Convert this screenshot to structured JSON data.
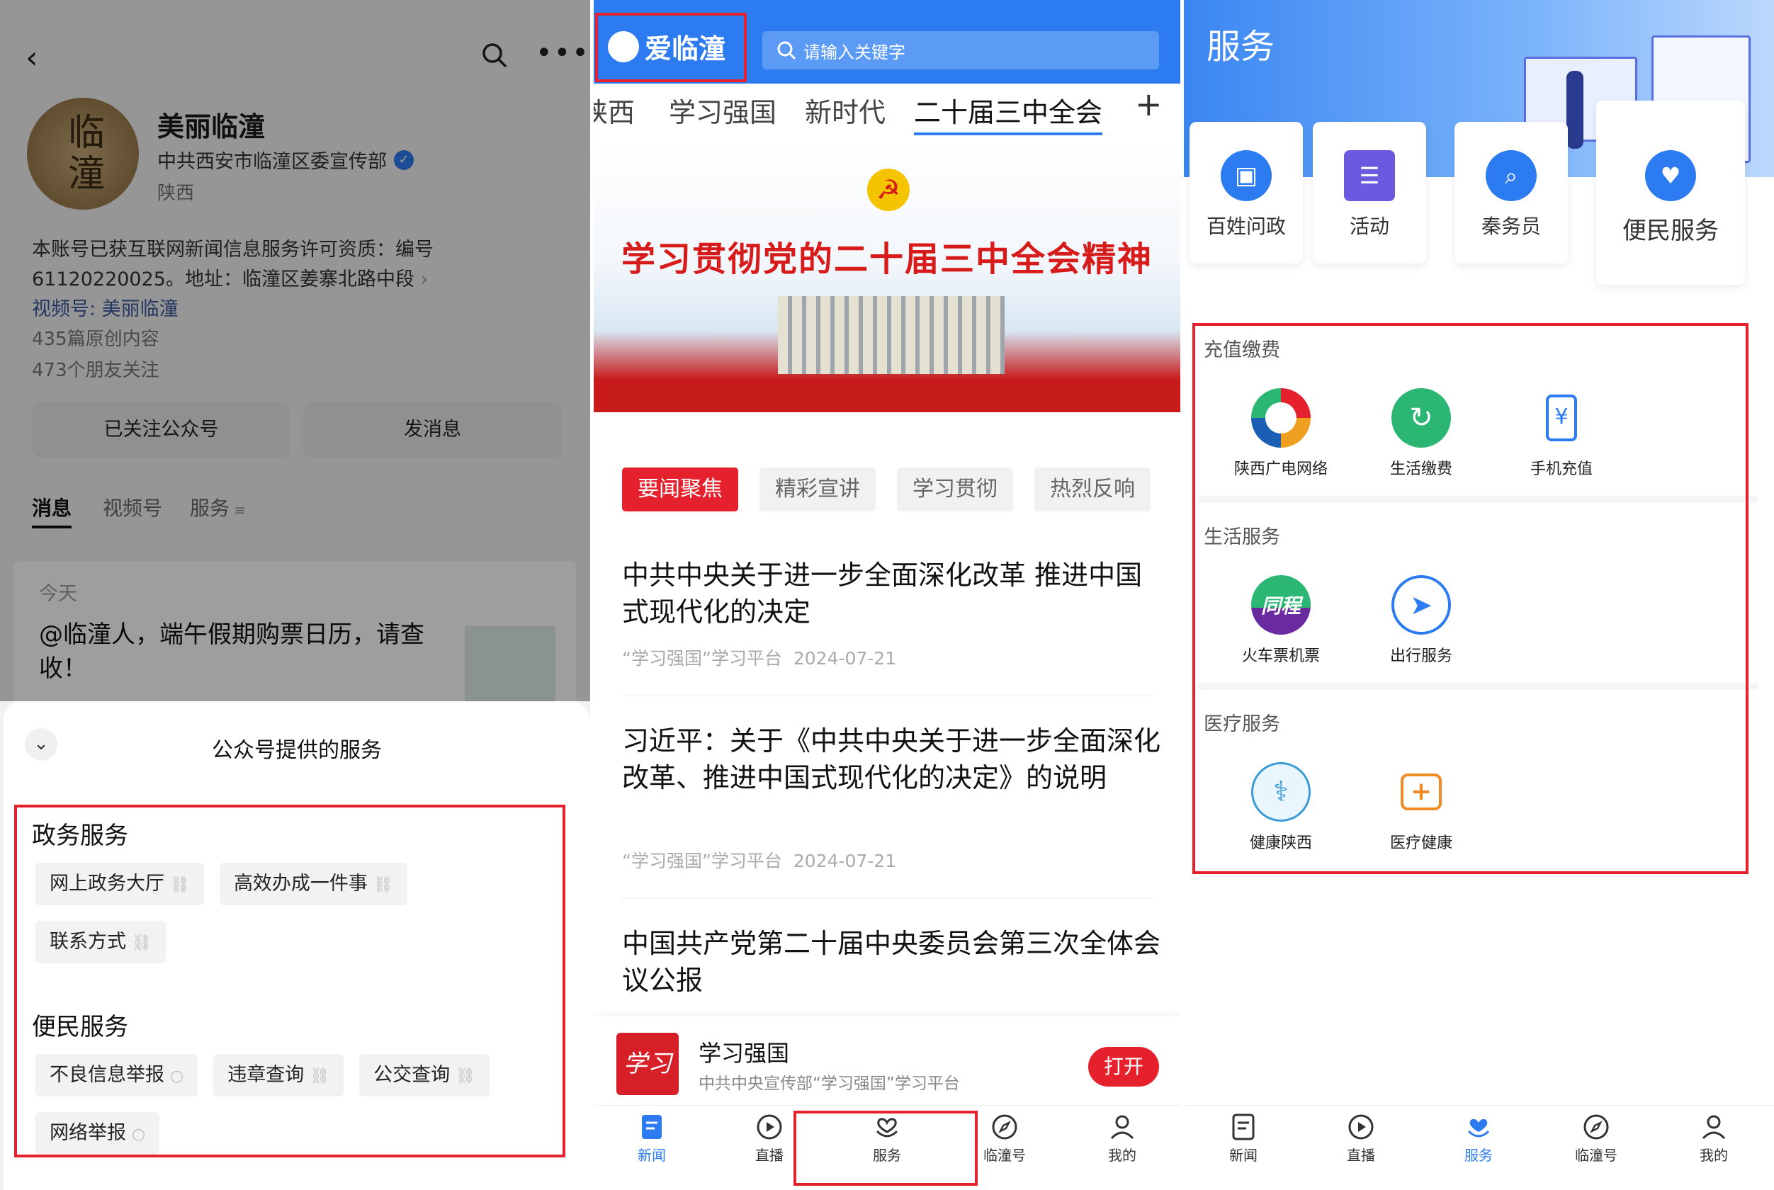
{
  "panel1": {
    "account_name": "美丽临潼",
    "org": "中共西安市临潼区委宣传部",
    "region": "陕西",
    "avatar_text": "临潼",
    "desc1": "本账号已获互联网新闻信息服务许可资质：编号",
    "desc2": "61120220025。地址：临潼区姜寨北路中段",
    "channel": "视频号: 美丽临潼",
    "original": "435篇原创内容",
    "followers": "473个朋友关注",
    "btn_followed": "已关注公众号",
    "btn_message": "发消息",
    "tabs": [
      "消息",
      "视频号",
      "服务"
    ],
    "today": "今天",
    "msg": "@临潼人，端午假期购票日历，请查收！",
    "sheet_title": "公众号提供的服务",
    "group1_title": "政务服务",
    "group1_items": [
      "网上政务大厅",
      "高效办成一件事",
      "联系方式"
    ],
    "group2_title": "便民服务",
    "group2_items": [
      "不良信息举报",
      "违章查询",
      "公交查询",
      "网络举报"
    ]
  },
  "panel2": {
    "logo": "爱临潼",
    "search_placeholder": "请输入关键字",
    "nav_tabs": [
      "陕西",
      "学习强国",
      "新时代",
      "二十届三中全会"
    ],
    "banner_text": "学习贯彻党的二十届三中全会精神",
    "cat_tabs": [
      "要闻聚焦",
      "精彩宣讲",
      "学习贯彻",
      "热烈反响"
    ],
    "news": [
      {
        "title": "中共中央关于进一步全面深化改革 推进中国式现代化的决定",
        "source": "“学习强国”学习平台",
        "date": "2024-07-21"
      },
      {
        "title": "习近平：关于《中共中央关于进一步全面深化改革、推进中国式现代化的决定》的说明",
        "source": "“学习强国”学习平台",
        "date": "2024-07-21"
      },
      {
        "title": "中国共产党第二十届中央委员会第三次全体会议公报",
        "source": "",
        "date": ""
      }
    ],
    "promo_title": "学习强国",
    "promo_sub": "中共中央宣传部“学习强国”学习平台",
    "promo_btn": "打开",
    "promo_logo": "学习",
    "bottom_nav": [
      "新闻",
      "直播",
      "服务",
      "临潼号",
      "我的"
    ]
  },
  "panel3": {
    "header": "服务",
    "quick": [
      "百姓问政",
      "活动",
      "秦务员",
      "便民服务"
    ],
    "sections": [
      {
        "title": "充值缴费",
        "items": [
          "陕西广电网络",
          "生活缴费",
          "手机充值"
        ]
      },
      {
        "title": "生活服务",
        "items": [
          "火车票机票",
          "出行服务"
        ]
      },
      {
        "title": "医疗服务",
        "items": [
          "健康陕西",
          "医疗健康"
        ]
      }
    ],
    "tongcheng_text": "同程",
    "bottom_nav": [
      "新闻",
      "直播",
      "服务",
      "临潼号",
      "我的"
    ]
  },
  "colors": {
    "accent_blue": "#2d7bf0",
    "red": "#e5212d",
    "green": "#2bb673",
    "orange": "#f08a24"
  }
}
